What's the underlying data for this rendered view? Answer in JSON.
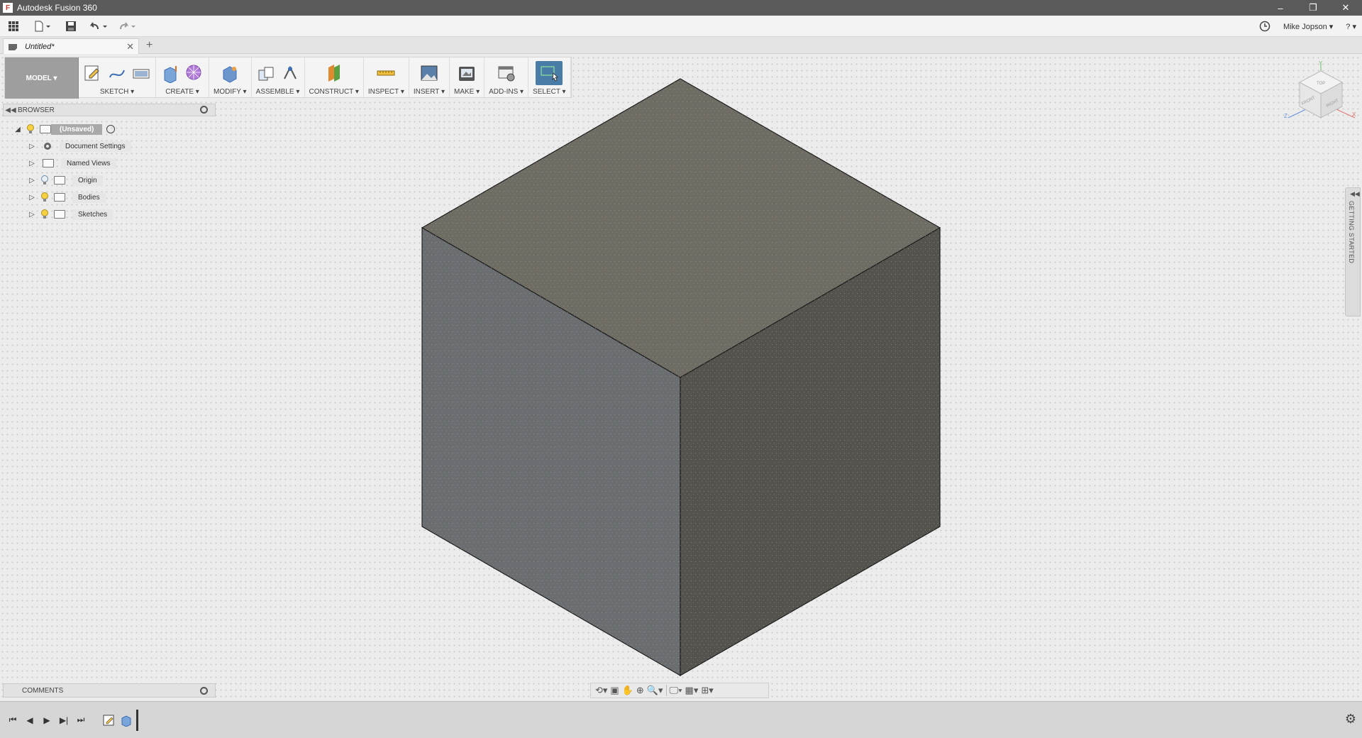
{
  "window": {
    "title": "Autodesk Fusion 360",
    "controls": [
      "–",
      "❐",
      "✕"
    ]
  },
  "quick_access": {
    "user_name": "Mike Jopson ▾",
    "help_label": "? ▾"
  },
  "document_tab": {
    "title": "Untitled*",
    "close": "✕",
    "new_tab": "+"
  },
  "ribbon": {
    "workspace": "MODEL ▾",
    "groups": [
      {
        "label": "SKETCH ▾"
      },
      {
        "label": "CREATE ▾"
      },
      {
        "label": "MODIFY ▾"
      },
      {
        "label": "ASSEMBLE ▾"
      },
      {
        "label": "CONSTRUCT ▾"
      },
      {
        "label": "INSPECT ▾"
      },
      {
        "label": "INSERT ▾"
      },
      {
        "label": "MAKE ▾"
      },
      {
        "label": "ADD-INS ▾"
      },
      {
        "label": "SELECT ▾"
      }
    ]
  },
  "browser": {
    "title": "BROWSER",
    "root": "(Unsaved)",
    "items": [
      {
        "label": "Document Settings"
      },
      {
        "label": "Named Views"
      },
      {
        "label": "Origin"
      },
      {
        "label": "Bodies"
      },
      {
        "label": "Sketches"
      }
    ]
  },
  "viewcube": {
    "top_face": "TOP",
    "front_face": "FRONT",
    "right_face": "RIGHT",
    "axis_x": "X",
    "axis_y": "Y",
    "axis_z": "Z"
  },
  "getting_started": {
    "label": "GETTING STARTED"
  },
  "comments": {
    "title": "COMMENTS"
  },
  "colors": {
    "cube_top": "#6f6c63",
    "cube_left": "#6b6e70",
    "cube_right": "#55534d",
    "select_accent": "#4a7ca8"
  }
}
